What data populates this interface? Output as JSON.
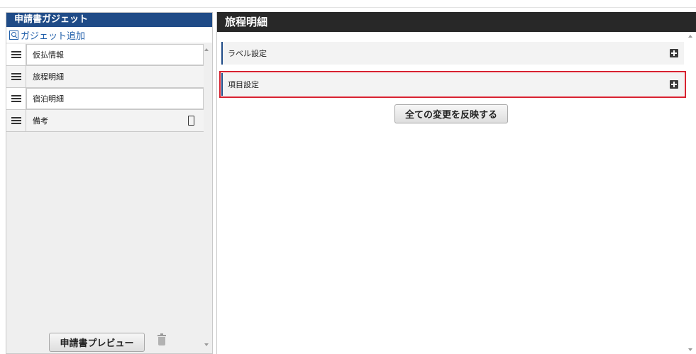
{
  "left_panel": {
    "title": "申請書ガジェット",
    "add_link": "ガジェット追加",
    "items": [
      {
        "label": "仮払情報"
      },
      {
        "label": "旅程明細"
      },
      {
        "label": "宿泊明細"
      },
      {
        "label": "備考"
      }
    ],
    "preview_label": "申請書プレビュー"
  },
  "right_panel": {
    "title": "旅程明細",
    "sections": [
      {
        "label": "ラベル設定"
      },
      {
        "label": "項目設定"
      }
    ],
    "apply_label": "全ての変更を反映する"
  },
  "colors": {
    "left_header": "#1f4b87",
    "right_header": "#282828",
    "highlight": "#d6212f",
    "link": "#1f5ea9"
  }
}
